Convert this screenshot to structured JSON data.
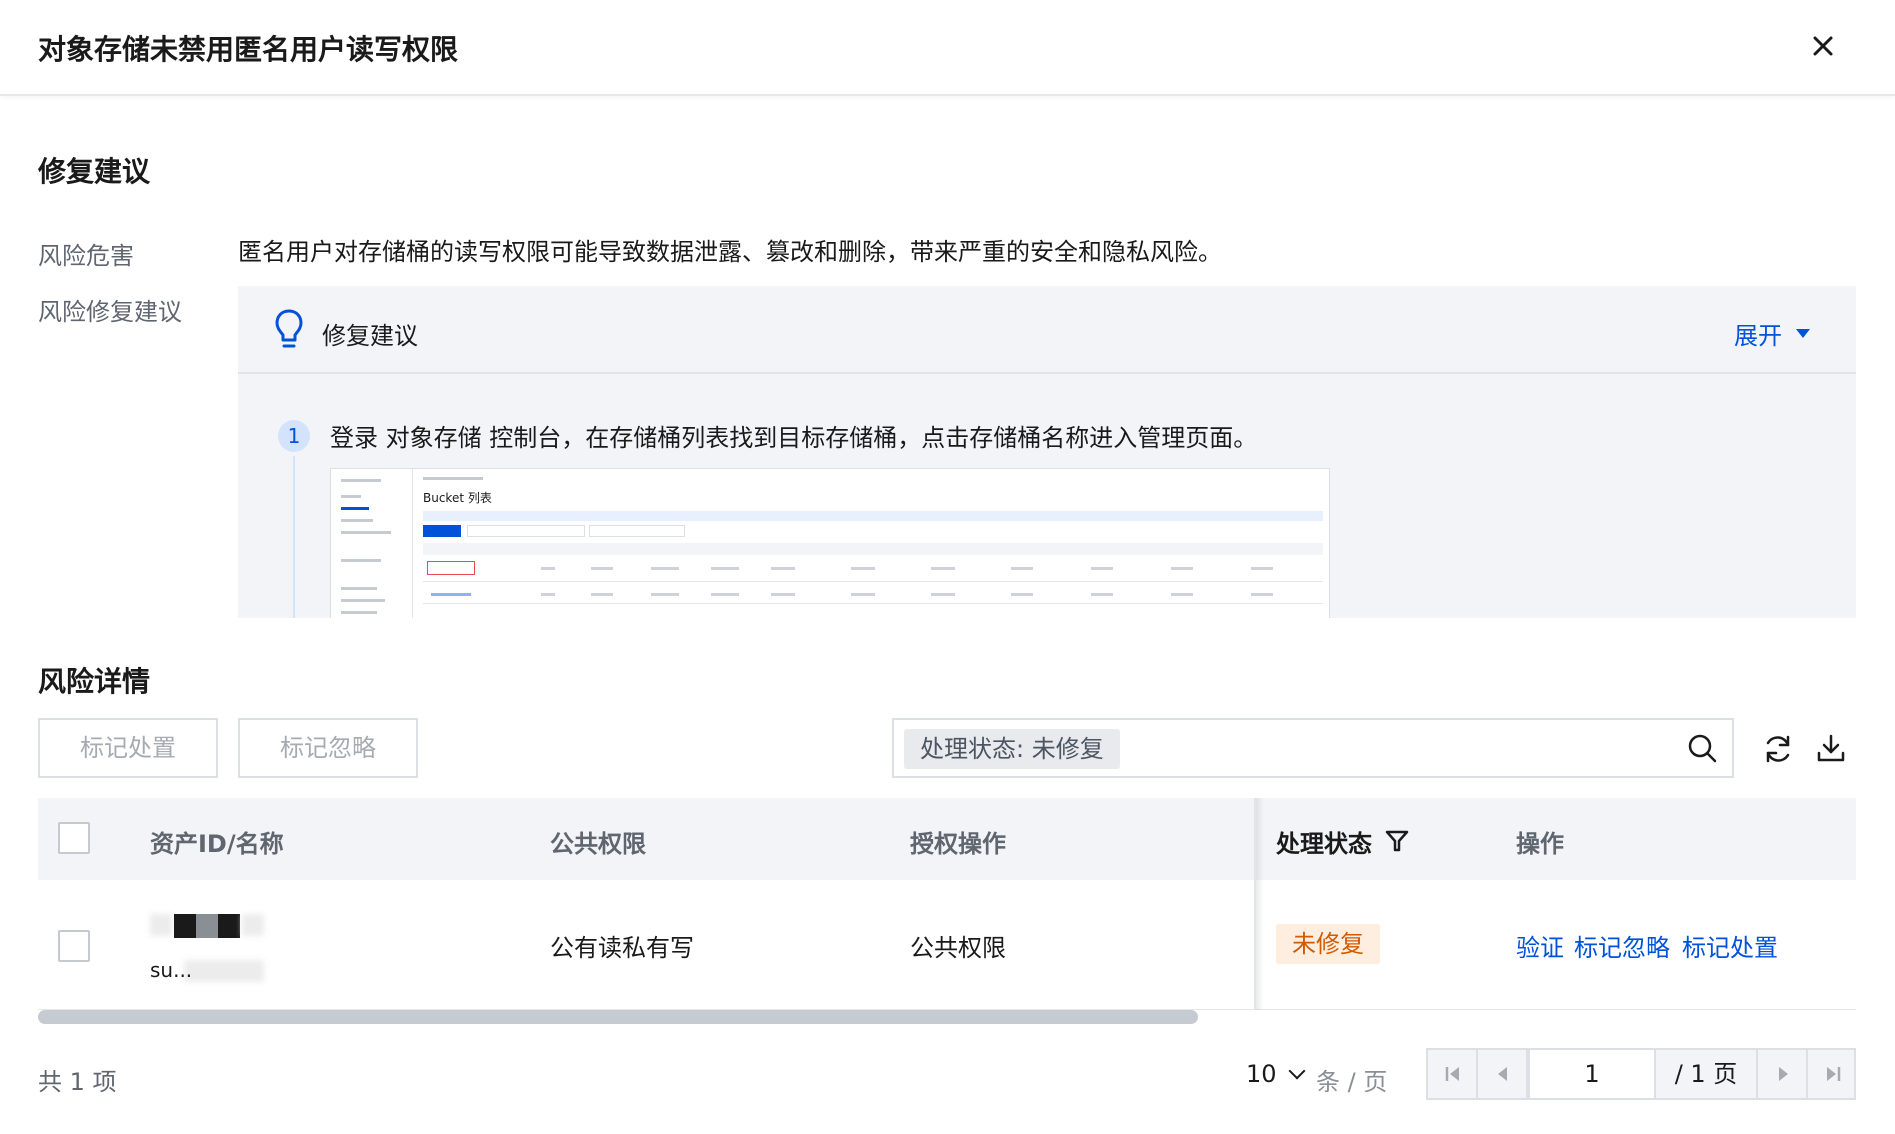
{
  "dialog": {
    "title": "对象存储未禁用匿名用户读写权限"
  },
  "fix_section": {
    "title": "修复建议",
    "risk_harm_label": "风险危害",
    "risk_harm_text": "匿名用户对存储桶的读写权限可能导致数据泄露、篡改和删除，带来严重的安全和隐私风险。",
    "risk_fix_label": "风险修复建议",
    "advice_box": {
      "header_label": "修复建议",
      "expand_label": "展开",
      "steps": [
        {
          "number": "1",
          "text": "登录 对象存储 控制台，在存储桶列表找到目标存储桶，点击存储桶名称进入管理页面。",
          "screenshot_title": "Bucket 列表"
        }
      ]
    }
  },
  "detail_section": {
    "title": "风险详情",
    "toolbar": {
      "mark_handled_label": "标记处置",
      "mark_ignored_label": "标记忽略",
      "search_filter_tag": "处理状态: 未修复"
    },
    "table": {
      "columns": [
        "资产ID/名称",
        "公共权限",
        "授权操作",
        "处理状态",
        "操作"
      ],
      "rows": [
        {
          "asset_name_partial": "su...",
          "public_permission": "公有读私有写",
          "auth_operation": "公共权限",
          "status": "未修复",
          "actions": [
            "验证",
            "标记忽略",
            "标记处置"
          ]
        }
      ]
    },
    "pagination": {
      "total_text": "共 1 项",
      "page_size": "10",
      "per_page_text": "条 / 页",
      "current_page": "1",
      "total_pages_text": "/ 1 页"
    }
  },
  "colors": {
    "primary_blue": "#0052d9",
    "status_orange_bg": "#fdeee0",
    "status_orange_text": "#d35a00",
    "panel_bg": "#f3f4f7"
  }
}
